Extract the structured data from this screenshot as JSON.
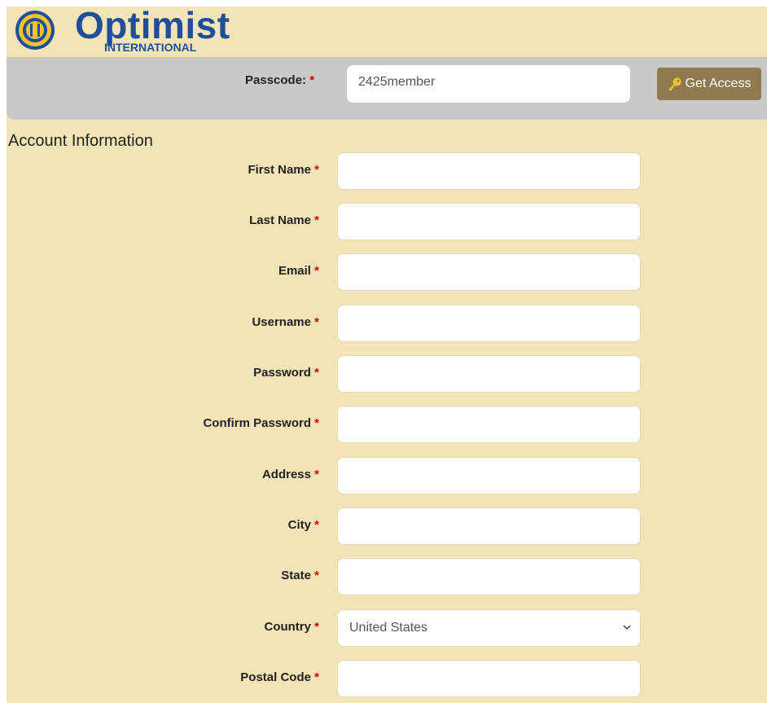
{
  "logo": {
    "word": "Optimist",
    "sub": "INTERNATIONAL"
  },
  "passcode": {
    "label": "Passcode:",
    "required": "*",
    "value": "2425member",
    "button": "Get Access"
  },
  "section_title": "Account Information",
  "fields": [
    {
      "label": "First Name",
      "required": "*",
      "value": ""
    },
    {
      "label": "Last Name",
      "required": "*",
      "value": ""
    },
    {
      "label": "Email",
      "required": "*",
      "value": ""
    },
    {
      "label": "Username",
      "required": "*",
      "value": ""
    },
    {
      "label": "Password",
      "required": "*",
      "value": ""
    },
    {
      "label": "Confirm Password",
      "required": "*",
      "value": ""
    },
    {
      "label": "Address",
      "required": "*",
      "value": ""
    },
    {
      "label": "City",
      "required": "*",
      "value": ""
    },
    {
      "label": "State",
      "required": "*",
      "value": ""
    },
    {
      "label": "Country",
      "required": "*",
      "value": "United States"
    },
    {
      "label": "Postal Code",
      "required": "*",
      "value": ""
    }
  ],
  "colors": {
    "page_bg": "#f2e4b7",
    "passbar_bg": "#c9c9c9",
    "button_bg": "#8f7a4f",
    "required": "#d40000",
    "brand": "#1f4e9a"
  }
}
